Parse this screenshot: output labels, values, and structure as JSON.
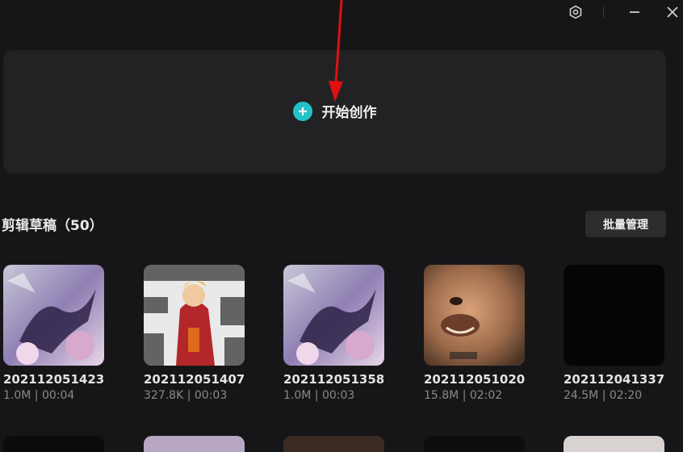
{
  "titlebar": {
    "settings_icon": "settings-hex-icon",
    "minimize_icon": "minimize-icon",
    "close_icon": "close-icon"
  },
  "create": {
    "label": "开始创作",
    "icon": "plus-circle-icon",
    "accent": "#23c2c9"
  },
  "drafts": {
    "title": "剪辑草稿（50）",
    "batch_label": "批量管理",
    "items": [
      {
        "name": "202112051423",
        "meta": "1.0M | 00:04",
        "thumb": "anime-purple-dragon"
      },
      {
        "name": "202112051407",
        "meta": "327.8K | 00:03",
        "thumb": "anime-ninja-manga"
      },
      {
        "name": "202112051358",
        "meta": "1.0M | 00:03",
        "thumb": "anime-purple-dragon"
      },
      {
        "name": "202112051020",
        "meta": "15.8M | 02:02",
        "thumb": "monkey-king-face"
      },
      {
        "name": "202112041337",
        "meta": "24.5M | 02:20",
        "thumb": "black"
      }
    ]
  },
  "annotation": {
    "color": "#e01010"
  }
}
